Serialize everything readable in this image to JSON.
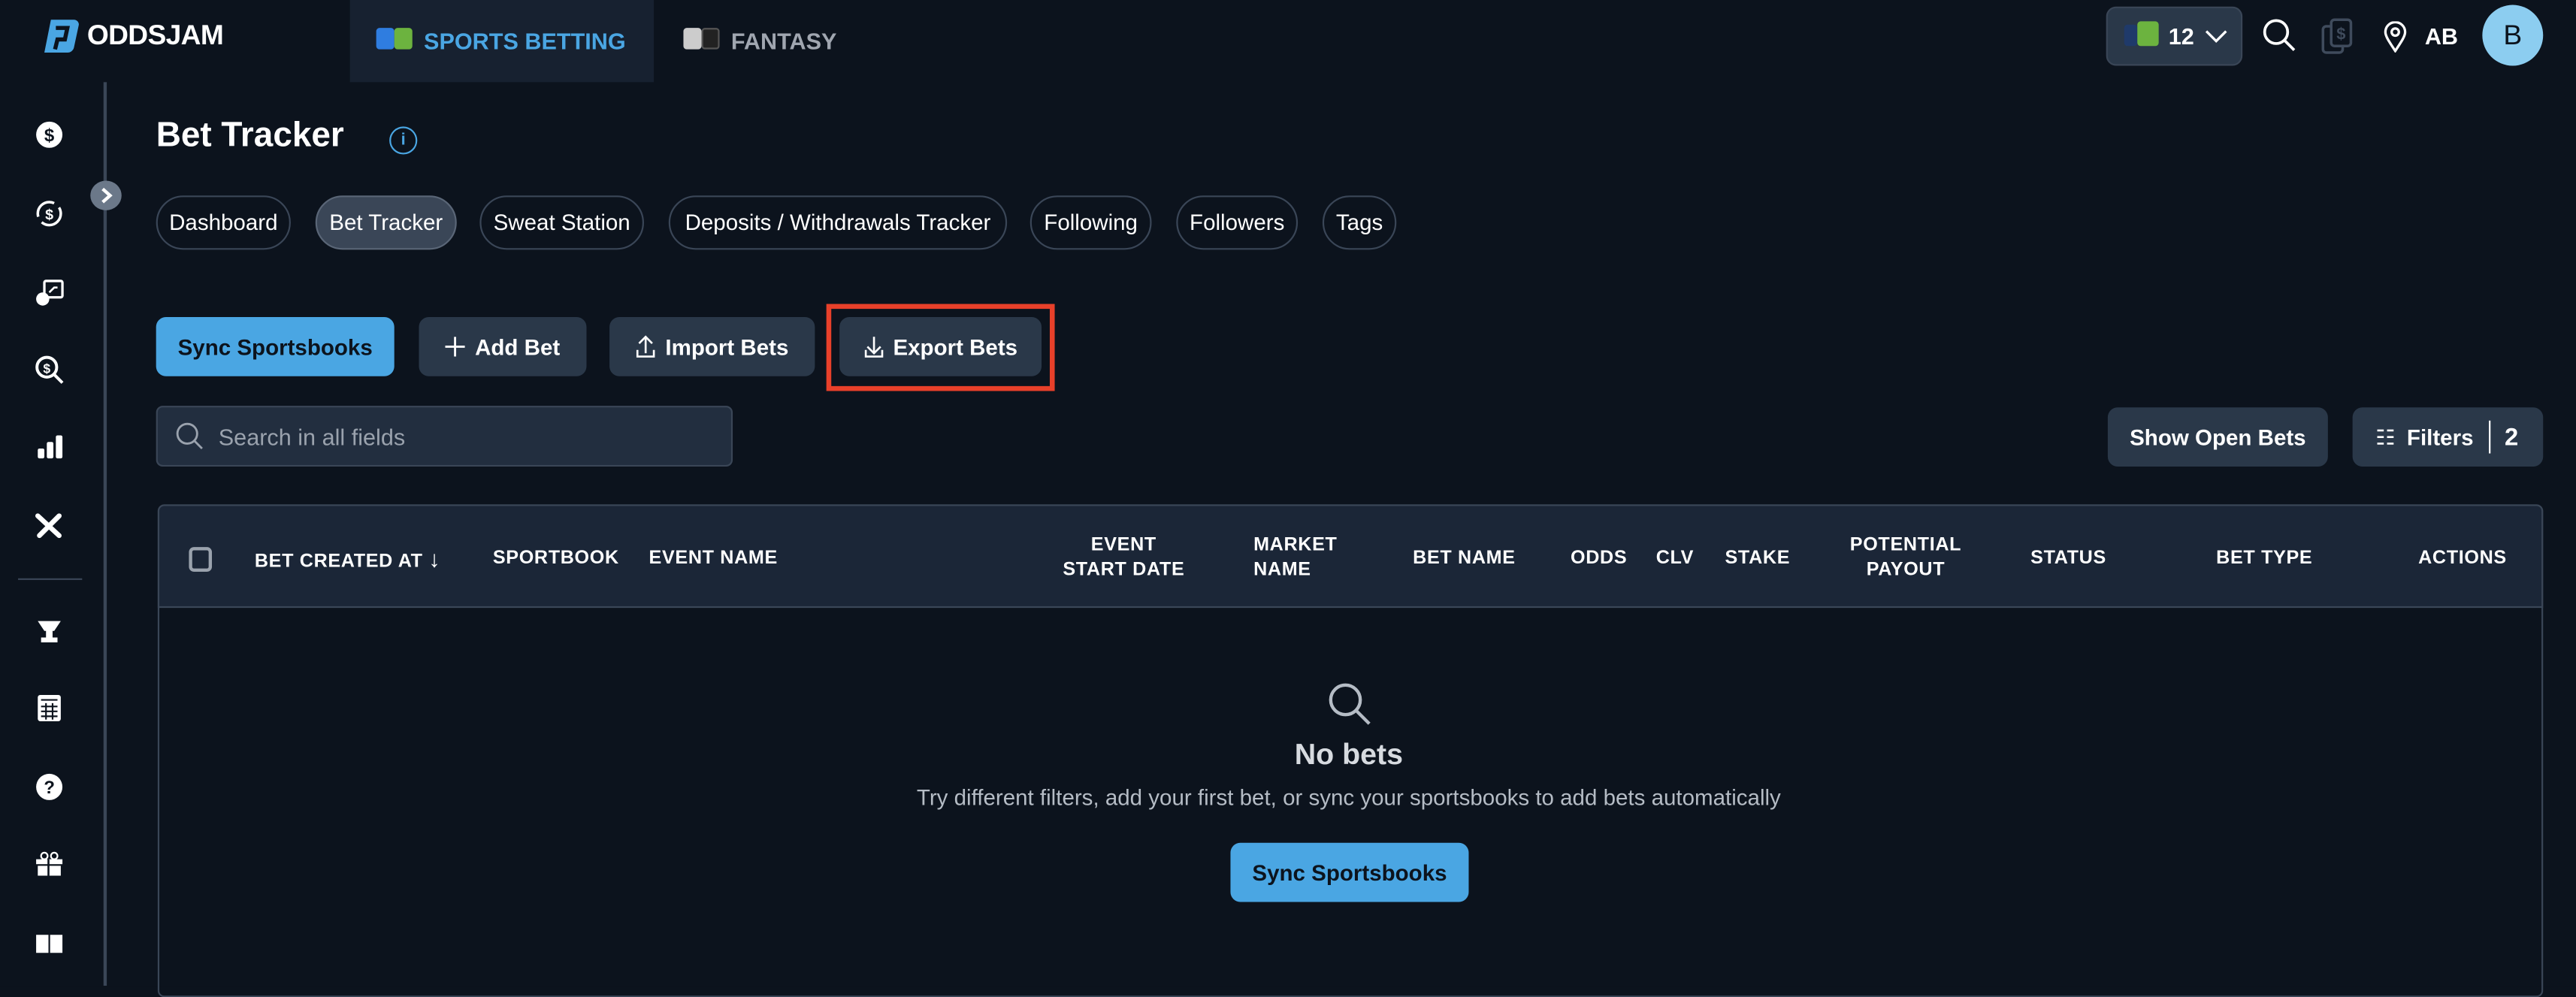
{
  "header": {
    "brand": "ODDSJAM",
    "tabs": [
      {
        "label": "SPORTS BETTING"
      },
      {
        "label": "FANTASY"
      }
    ],
    "book_count": "12",
    "user_initials": "AB",
    "avatar_letter": "B"
  },
  "sidebar": {
    "icons": [
      "dollar-badge-icon",
      "dollar-refresh-icon",
      "dollar-chart-icon",
      "dollar-search-icon",
      "bar-chart-icon",
      "tools-icon",
      "trophy-icon",
      "calculator-icon",
      "help-icon",
      "gift-icon",
      "book-icon"
    ]
  },
  "page": {
    "title": "Bet Tracker",
    "info_icon": "i",
    "subtabs": [
      {
        "label": "Dashboard"
      },
      {
        "label": "Bet Tracker"
      },
      {
        "label": "Sweat Station"
      },
      {
        "label": "Deposits / Withdrawals Tracker"
      },
      {
        "label": "Following"
      },
      {
        "label": "Followers"
      },
      {
        "label": "Tags"
      }
    ]
  },
  "toolbar": {
    "sync": "Sync Sportsbooks",
    "add": "Add Bet",
    "import": "Import Bets",
    "export": "Export Bets",
    "search_placeholder": "Search in all fields",
    "show_open": "Show Open Bets",
    "filters": "Filters",
    "filters_count": "2"
  },
  "table": {
    "columns": [
      "BET CREATED AT",
      "SPORTBOOK",
      "EVENT NAME",
      "EVENT",
      "START DATE",
      "MARKET",
      "NAME",
      "BET NAME",
      "ODDS",
      "CLV",
      "STAKE",
      "POTENTIAL",
      "PAYOUT",
      "STATUS",
      "BET TYPE",
      "ACTIONS"
    ]
  },
  "empty": {
    "title": "No bets",
    "subtitle": "Try different filters, add your first bet, or sync your sportsbooks to add bets automatically",
    "button": "Sync Sportsbooks"
  },
  "colors": {
    "accent": "#4aa6e3",
    "background": "#0c131d",
    "highlight": "#e8402a"
  }
}
